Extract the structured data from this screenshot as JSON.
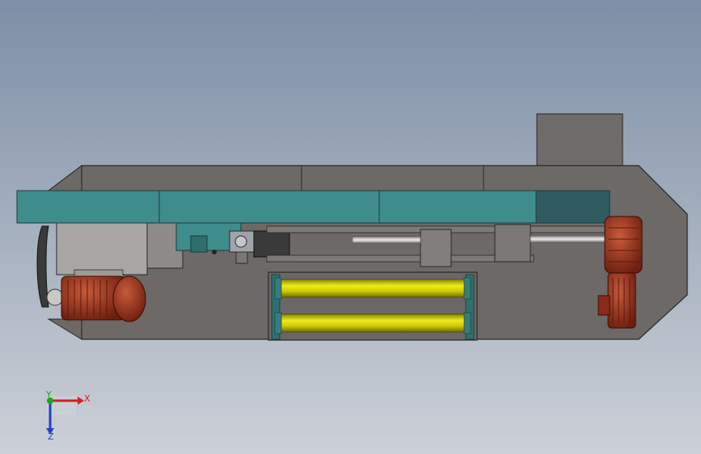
{
  "scene": {
    "background_top": "#7d8fa6",
    "background_bottom": "#c9ced6",
    "frame_color": "#6e6b68",
    "frame_edge": "#2a2826",
    "conveyor_color": "#3f8c8c",
    "conveyor_dark": "#2f5a60",
    "motor_red": "#a33a24",
    "roller_yellow": "#d8d400",
    "bearing_teal": "#2f6f6f",
    "shaft_gray": "#c9c9c9"
  },
  "axis_triad": {
    "x_label": "X",
    "y_label": "Y",
    "z_label": "Z",
    "x_color": "#d42020",
    "y_color": "#18a818",
    "z_color": "#2040c8"
  }
}
